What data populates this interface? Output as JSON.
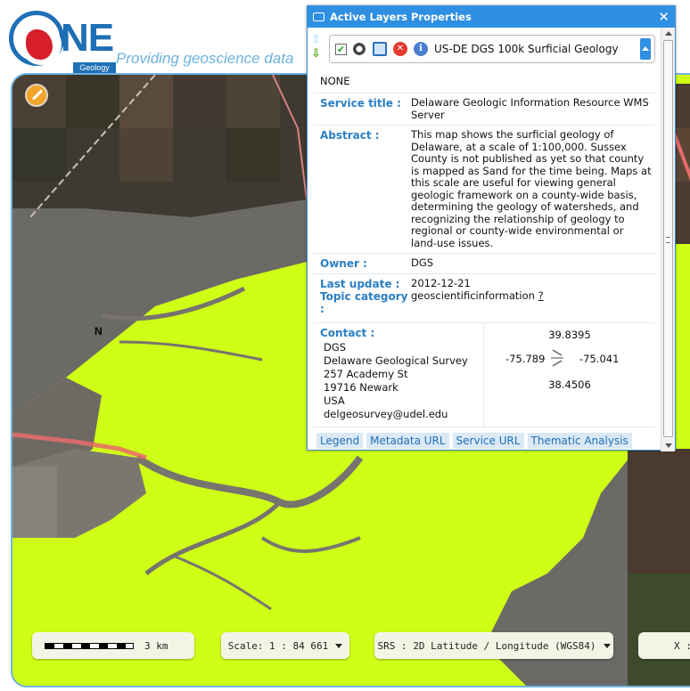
{
  "header": {
    "logo_text": "NE",
    "logo_sub": "Geology",
    "tagline": "Providing geoscience data"
  },
  "map": {
    "place_label": "N"
  },
  "panel": {
    "title": "Active Layers Properties",
    "close_symbol": "✕",
    "layer": {
      "checked_symbol": "✔",
      "delete_symbol": "✕",
      "info_symbol": "i",
      "name": "US-DE DGS 100k Surficial Geology"
    },
    "style": "NONE",
    "service_title_label": "Service title :",
    "service_title": "Delaware Geologic Information Resource WMS Server",
    "abstract_label": "Abstract :",
    "abstract": "This map shows the surficial geology of Delaware, at a scale of 1:100,000. Sussex County is not published as yet so that county is mapped as Sand for the time being. Maps at this scale are useful for viewing general geologic framework on a county-wide basis, determining the geology of watersheds, and recognizing the relationship of geology to regional or county-wide environmental or land-use issues.",
    "owner_label": "Owner :",
    "owner": "DGS",
    "last_update_label": "Last update :",
    "last_update": "2012-12-21",
    "topic_label": "Topic category :",
    "topic": "geoscientificinformation",
    "topic_help": "?",
    "contact": {
      "label": "Contact :",
      "lines": [
        "DGS",
        "Delaware Geological Survey",
        "257 Academy St",
        "19716 Newark",
        "USA",
        "delgeosurvey@udel.edu"
      ]
    },
    "bbox": {
      "north": "39.8395",
      "west": "-75.789",
      "east": "-75.041",
      "south": "38.4506"
    },
    "tabs": [
      "Legend",
      "Metadata URL",
      "Service URL",
      "Thematic Analysis"
    ]
  },
  "controls": {
    "scalebar_label": "3 km",
    "scale": "Scale: 1 : 84 661",
    "srs": "SRS : 2D Latitude / Longitude (WGS84)",
    "coord_prefix": "X :"
  },
  "colors": {
    "geology_fill": "#cfff17",
    "panel_titlebar": "#2e8fe3",
    "label_blue": "#2b7fc4",
    "road_red": "#e86b6b"
  }
}
